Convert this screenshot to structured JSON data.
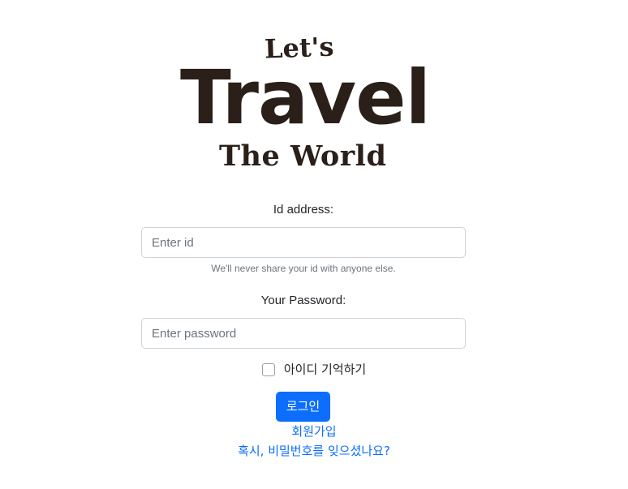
{
  "logo": {
    "lets": "Let's",
    "travel": "Travel",
    "world": "The World"
  },
  "form": {
    "id_label": "Id address:",
    "id_placeholder": "Enter id",
    "id_help": "We'll never share your id with anyone else.",
    "password_label": "Your Password:",
    "password_placeholder": "Enter password",
    "remember_label": "아이디 기억하기",
    "remember_checked": false,
    "login_button": "로그인",
    "signup_link": "회원가입",
    "forgot_link": "혹시, 비밀번호를 잊으셨나요?"
  },
  "colors": {
    "primary": "#0d6efd",
    "logo": "#2a2019",
    "border": "#ced4da"
  }
}
